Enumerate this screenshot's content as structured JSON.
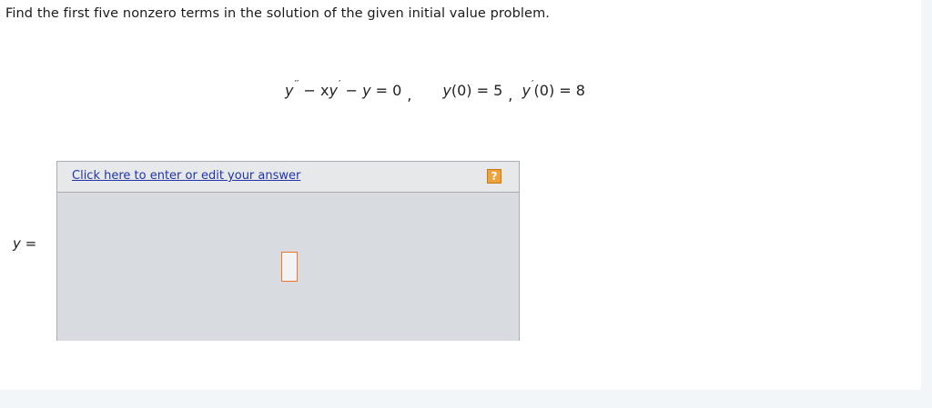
{
  "question": {
    "text": "Find the first five nonzero terms in the solution of the given initial value problem."
  },
  "equation": {
    "ode_y": "y",
    "ode_primes_1": "′′",
    "ode_mid_1": " − x",
    "ode_y2": "y",
    "ode_primes_2": "′",
    "ode_mid_2": " − ",
    "ode_y3": "y",
    "ode_rhs": " = 0",
    "comma_1": ",",
    "ic1_y": "y",
    "ic1_rest": "(0) = 5",
    "comma_2": ",",
    "ic2_y": "y",
    "ic2_prime": "′",
    "ic2_rest": "(0) = 8"
  },
  "answer": {
    "label_var": "y",
    "label_eq": " =",
    "link_text": "Click here to enter or edit your answer",
    "help_icon": "?"
  },
  "colors": {
    "link": "#2233aa",
    "help_icon_bg": "#f0a23a",
    "input_border": "#e8752b",
    "answer_bg": "#d8dbdf"
  }
}
